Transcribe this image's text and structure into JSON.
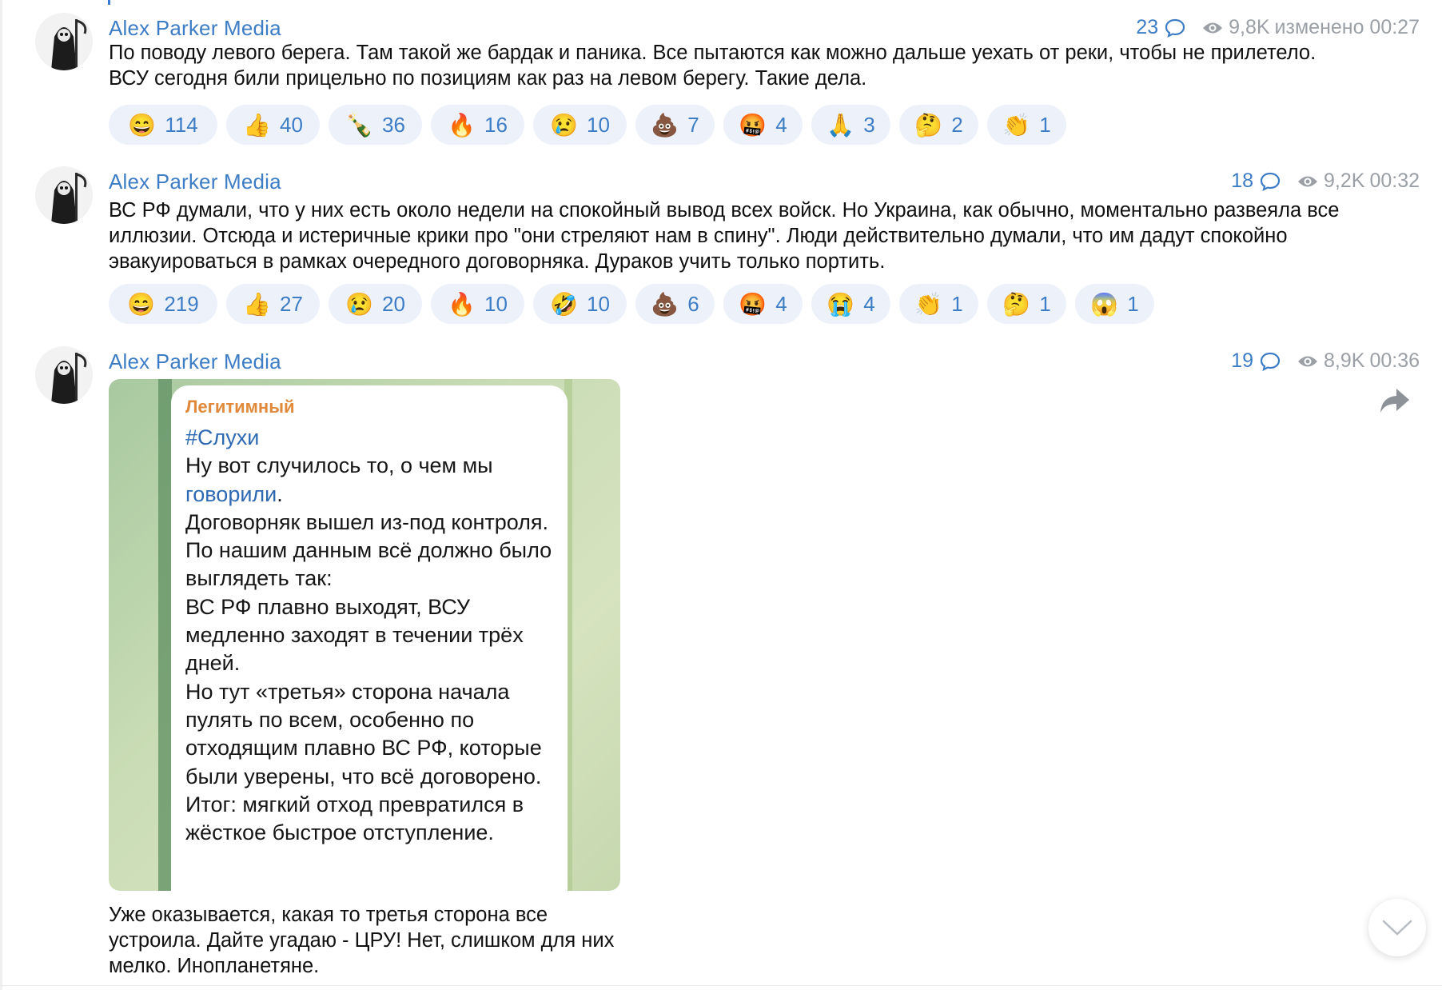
{
  "messages": [
    {
      "sender": "Alex Parker Media",
      "comments": "23",
      "views": "9,8K",
      "time": "изменено 00:27",
      "text": "По поводу левого берега. Там такой же бардак и паника. Все пытаются как можно дальше уехать от реки, чтобы не прилетело. ВСУ сегодня били прицельно по позициям как раз на левом берегу. Такие дела.",
      "reactions": [
        {
          "emoji": "😄",
          "count": "114"
        },
        {
          "emoji": "👍",
          "count": "40"
        },
        {
          "emoji": "🍾",
          "count": "36"
        },
        {
          "emoji": "🔥",
          "count": "16"
        },
        {
          "emoji": "😢",
          "count": "10"
        },
        {
          "emoji": "💩",
          "count": "7"
        },
        {
          "emoji": "🤬",
          "count": "4"
        },
        {
          "emoji": "🙏",
          "count": "3"
        },
        {
          "emoji": "🤔",
          "count": "2"
        },
        {
          "emoji": "👏",
          "count": "1"
        }
      ]
    },
    {
      "sender": "Alex Parker Media",
      "comments": "18",
      "views": "9,2K",
      "time": "00:32",
      "text": "ВС РФ думали, что у них есть около недели на спокойный вывод всех войск. Но Украина, как обычно, моментально развеяла все иллюзии. Отсюда и истеричные крики про \"они стреляют нам в спину\". Люди действительно думали, что им дадут спокойно эвакуироваться в рамках очередного договорняка. Дураков учить только портить.",
      "reactions": [
        {
          "emoji": "😄",
          "count": "219"
        },
        {
          "emoji": "👍",
          "count": "27"
        },
        {
          "emoji": "😢",
          "count": "20"
        },
        {
          "emoji": "🔥",
          "count": "10"
        },
        {
          "emoji": "🤣",
          "count": "10"
        },
        {
          "emoji": "💩",
          "count": "6"
        },
        {
          "emoji": "🤬",
          "count": "4"
        },
        {
          "emoji": "😭",
          "count": "4"
        },
        {
          "emoji": "👏",
          "count": "1"
        },
        {
          "emoji": "🤔",
          "count": "1"
        },
        {
          "emoji": "😱",
          "count": "1"
        }
      ]
    },
    {
      "sender": "Alex Parker Media",
      "comments": "19",
      "views": "8,9K",
      "time": "00:36",
      "photo": {
        "forward_from": "Легитимный",
        "hashtag": "#Слухи",
        "line_1_pre": "Ну вот случилось то, о чем мы ",
        "line_1_link": "говорили",
        "line_1_post": ".",
        "body": "Договорняк вышел из-под контроля.\nПо нашим данным всё должно было выглядеть так:\nВС РФ плавно выходят, ВСУ медленно заходят в течении трёх дней.\nНо тут «третья» сторона начала пулять по всем, особенно по отходящим плавно ВС РФ, которые были уверены, что всё договорено.\nИтог: мягкий отход превратился в жёсткое быстрое отступление."
      },
      "text": "Уже оказывается, какая то третья сторона все устроила. Дайте угадаю - ЦРУ! Нет, слишком для них мелко. Инопланетяне."
    }
  ],
  "icons": {
    "comment": "comment-bubble-icon",
    "views": "eye-icon",
    "share": "share-arrow-icon",
    "scroll": "chevron-down-icon"
  },
  "colors": {
    "accent": "#3d7dc6",
    "reaction_bg": "#edf2fa",
    "meta_gray": "#9aa0a6",
    "forward_orange": "#e0893a"
  }
}
